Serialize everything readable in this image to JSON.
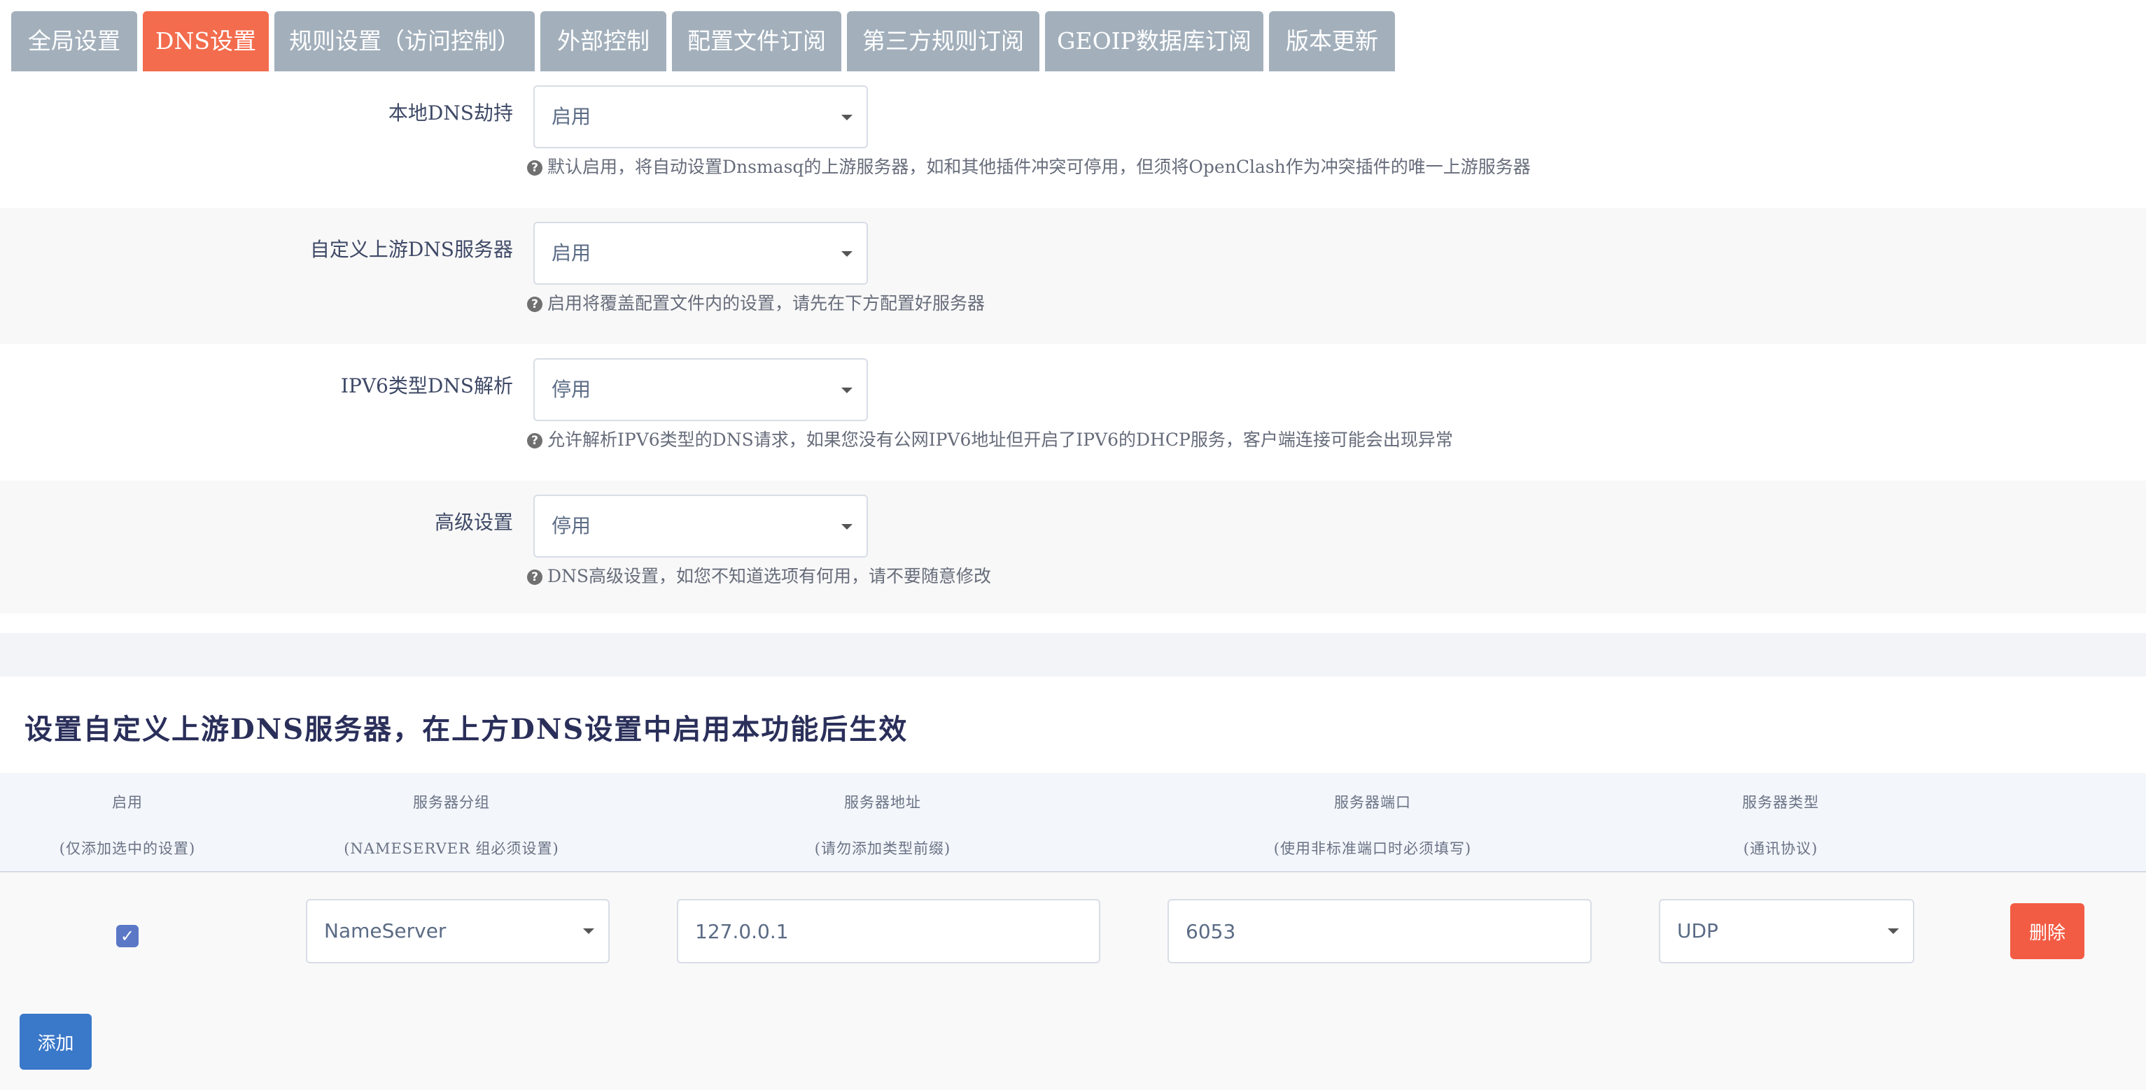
{
  "tabs": [
    "全局设置",
    "DNS设置",
    "规则设置（访问控制）",
    "外部控制",
    "配置文件订阅",
    "第三方规则订阅",
    "GEOIP数据库订阅",
    "版本更新"
  ],
  "settings": [
    {
      "label": "本地DNS劫持",
      "value": "启用",
      "help": "默认启用，将自动设置Dnsmasq的上游服务器，如和其他插件冲突可停用，但须将OpenClash作为冲突插件的唯一上游服务器"
    },
    {
      "label": "自定义上游DNS服务器",
      "value": "启用",
      "help": "启用将覆盖配置文件内的设置，请先在下方配置好服务器"
    },
    {
      "label": "IPV6类型DNS解析",
      "value": "停用",
      "help": "允许解析IPV6类型的DNS请求，如果您没有公网IPV6地址但开启了IPV6的DHCP服务，客户端连接可能会出现异常"
    },
    {
      "label": "高级设置",
      "value": "停用",
      "help": "DNS高级设置，如您不知道选项有何用，请不要随意修改"
    }
  ],
  "section_title": "设置自定义上游DNS服务器，在上方DNS设置中启用本功能后生效",
  "table": {
    "headers": [
      {
        "title": "启用",
        "sub": "(仅添加选中的设置)"
      },
      {
        "title": "服务器分组",
        "sub": "(NAMESERVER 组必须设置)"
      },
      {
        "title": "服务器地址",
        "sub": "(请勿添加类型前缀)"
      },
      {
        "title": "服务器端口",
        "sub": "(使用非标准端口时必须填写)"
      },
      {
        "title": "服务器类型",
        "sub": "(通讯协议)"
      }
    ],
    "row": {
      "enabled": true,
      "checkmark": "✓",
      "group": "NameServer",
      "address": "127.0.0.1",
      "port": "6053",
      "type": "UDP",
      "delete_label": "删除"
    }
  },
  "add_label": "添加",
  "colors": {
    "active_tab": "#f36c4d",
    "tab": "#a3b0bc",
    "delete": "#f35c44",
    "add": "#3a78c9",
    "checkbox": "#5a78c6"
  }
}
